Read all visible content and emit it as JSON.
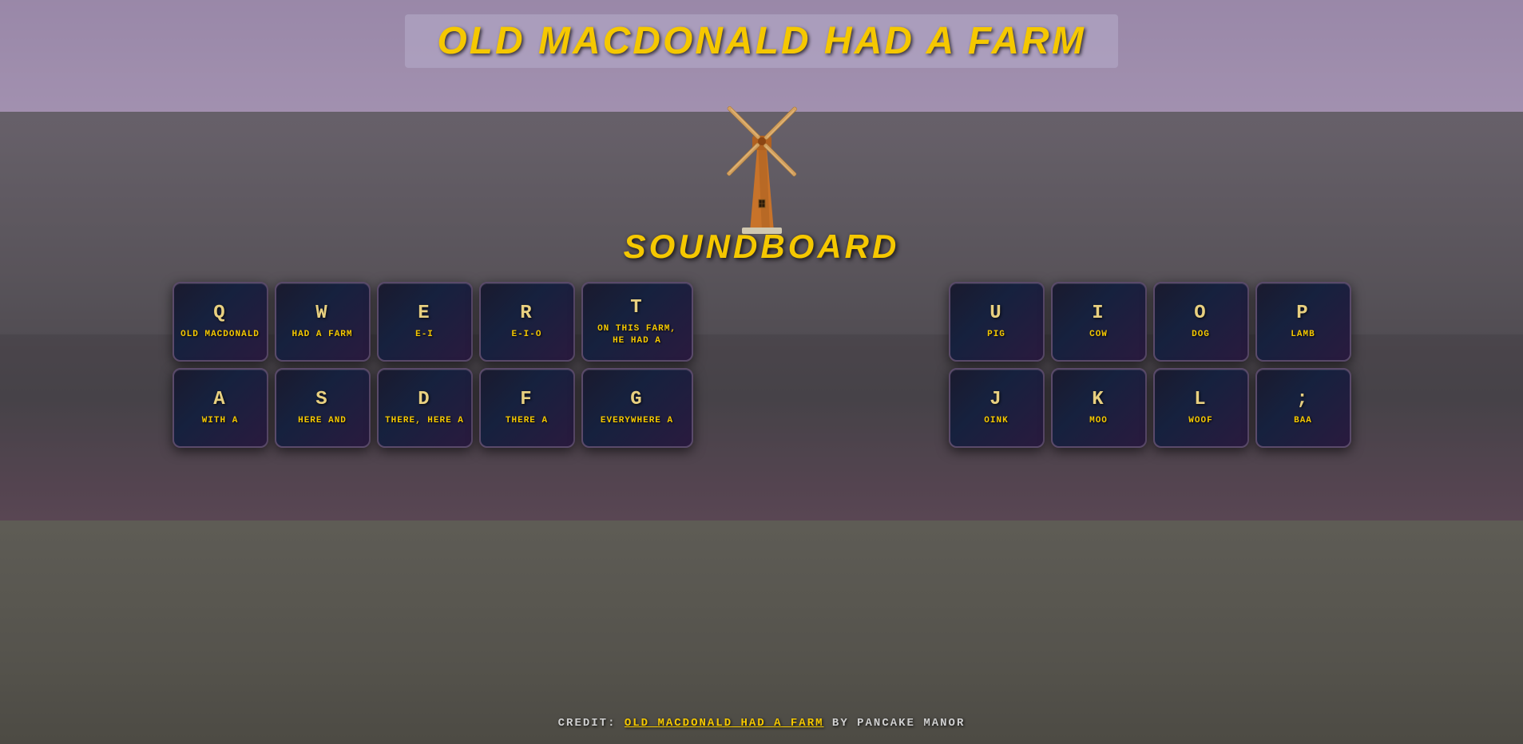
{
  "title": "OLD MACDONALD HAD A FARM",
  "subtitle": "SOUNDBOARD",
  "credit_prefix": "CREDIT: ",
  "credit_link_text": "OLD MACDONALD HAD A FARM",
  "credit_suffix": " BY PANCAKE MANOR",
  "left_group": {
    "row1": [
      {
        "key": "Q",
        "label": "OLD MACDONALD"
      },
      {
        "key": "W",
        "label": "HAD A FARM"
      },
      {
        "key": "E",
        "label": "E-I"
      },
      {
        "key": "R",
        "label": "E-I-O"
      },
      {
        "key": "T",
        "label": "ON THIS FARM,\nHE HAD A",
        "wide": true
      }
    ],
    "row2": [
      {
        "key": "A",
        "label": "WITH A"
      },
      {
        "key": "S",
        "label": "HERE AND"
      },
      {
        "key": "D",
        "label": "THERE, HERE A"
      },
      {
        "key": "F",
        "label": "THERE A"
      },
      {
        "key": "G",
        "label": "EVERYWHERE A",
        "wide": true
      }
    ]
  },
  "right_group": {
    "row1": [
      {
        "key": "U",
        "label": "PIG"
      },
      {
        "key": "I",
        "label": "COW"
      },
      {
        "key": "O",
        "label": "DOG"
      },
      {
        "key": "P",
        "label": "LAMB"
      }
    ],
    "row2": [
      {
        "key": "J",
        "label": "OINK"
      },
      {
        "key": "K",
        "label": "MOO"
      },
      {
        "key": "L",
        "label": "WOOF"
      },
      {
        "key": ";",
        "label": "BAA"
      }
    ]
  }
}
